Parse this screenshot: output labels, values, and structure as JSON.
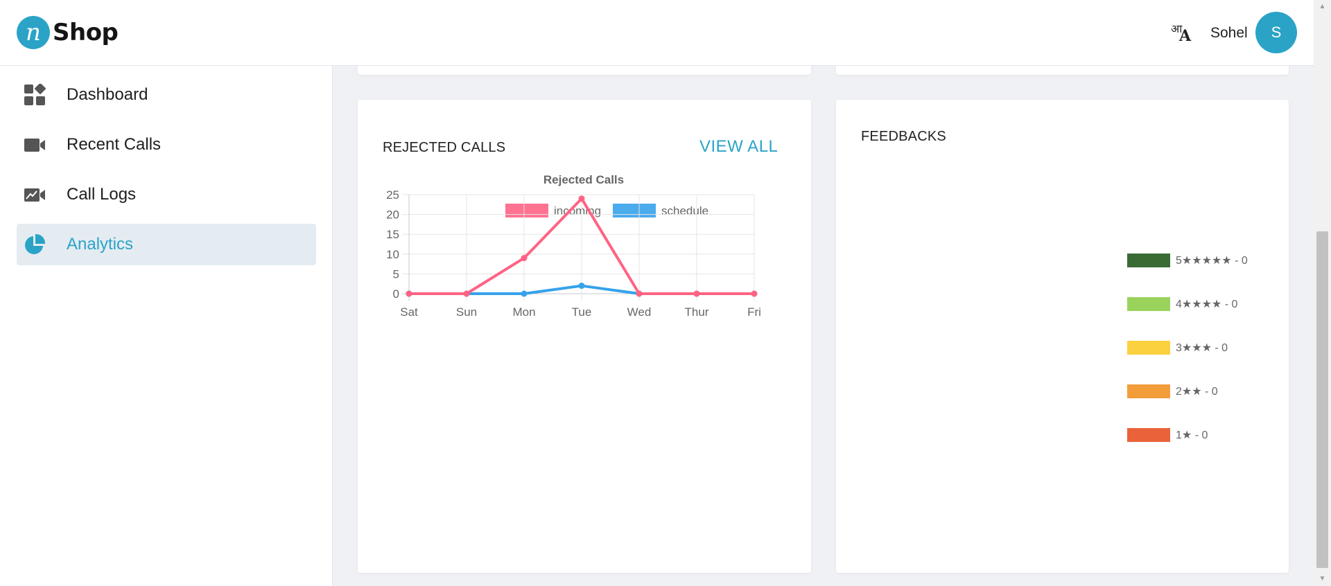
{
  "header": {
    "logo_mark": "n",
    "logo_text": "Shop",
    "lang_icon": "translate-icon",
    "user_name": "Sohel",
    "avatar_initial": "S"
  },
  "sidebar": {
    "items": [
      {
        "label": "Dashboard",
        "icon": "dashboard-icon",
        "active": false
      },
      {
        "label": "Recent Calls",
        "icon": "video-camera-icon",
        "active": false
      },
      {
        "label": "Call Logs",
        "icon": "call-log-icon",
        "active": false
      },
      {
        "label": "Analytics",
        "icon": "pie-chart-icon",
        "active": true
      }
    ]
  },
  "colors": {
    "accent": "#2ba3c7",
    "incoming": "#ff6384",
    "schedule": "#36a2eb"
  },
  "rejected_card": {
    "title": "REJECTED CALLS",
    "view_all": "VIEW ALL"
  },
  "feedback_card": {
    "title": "FEEDBACKS",
    "items": [
      {
        "label": "5★★★★★ - 0",
        "color": "#3a6b35"
      },
      {
        "label": "4★★★★ - 0",
        "color": "#99d35b"
      },
      {
        "label": "3★★★ - 0",
        "color": "#fcd13f"
      },
      {
        "label": "2★★ - 0",
        "color": "#f39c3a"
      },
      {
        "label": "1★ - 0",
        "color": "#e9623a"
      }
    ]
  },
  "chart_data": {
    "type": "line",
    "title": "Rejected Calls",
    "categories": [
      "Sat",
      "Sun",
      "Mon",
      "Tue",
      "Wed",
      "Thur",
      "Fri"
    ],
    "series": [
      {
        "name": "incoming",
        "values": [
          0,
          0,
          9,
          24,
          0,
          0,
          0
        ],
        "color": "#ff6384"
      },
      {
        "name": "schedule",
        "values": [
          0,
          0,
          0,
          2,
          0,
          0,
          0
        ],
        "color": "#36a2eb"
      }
    ],
    "ylim": [
      0,
      25
    ],
    "yticks": [
      "0",
      "5",
      "10",
      "15",
      "20",
      "25"
    ],
    "grid": true,
    "legend": "top"
  }
}
